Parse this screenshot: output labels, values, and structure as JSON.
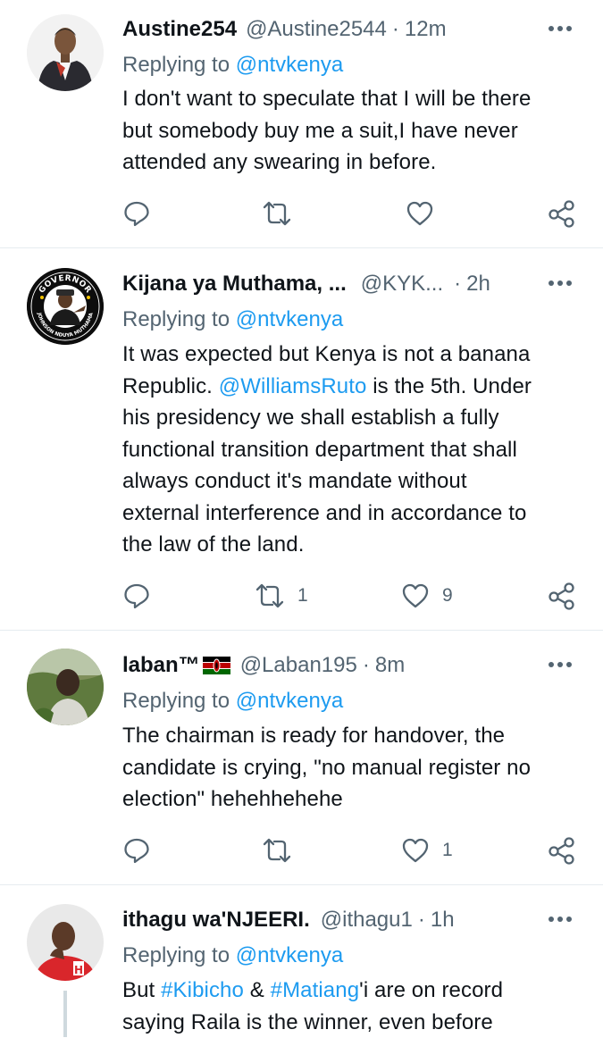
{
  "tweets": [
    {
      "name": "Austine254",
      "handle": "@Austine2544",
      "time": "12m",
      "replying_prefix": "Replying to ",
      "replying_handle": "@ntvkenya",
      "body_lines": [
        "I don't want to speculate that I will be there",
        "but somebody buy me a suit,I have never",
        "attended any swearing in before."
      ],
      "retweets": "",
      "likes": ""
    },
    {
      "name": "Kijana ya Muthama, ...",
      "handle": "@KYK...",
      "time": "2h",
      "replying_prefix": "Replying to ",
      "replying_handle": "@ntvkenya",
      "body_line1": "It was expected but Kenya is not a banana",
      "body_mention": "@WilliamsRuto",
      "body_line2_rest": " is the 5th. Under",
      "body_lines_rest": [
        "his presidency we shall establish a fully",
        "functional transition department that shall",
        "always conduct it's mandate without",
        "external interference and in accordance to",
        "the law of the land."
      ],
      "avatar_text_top": "GOVERNOR",
      "avatar_text_bottom": "JOHNSON NDUYA MUTHAMA",
      "retweets": "1",
      "likes": "9"
    },
    {
      "name": "laban™",
      "handle": "@Laban195",
      "time": "8m",
      "replying_prefix": "Replying to ",
      "replying_handle": "@ntvkenya",
      "body_lines": [
        "The chairman is ready for handover, the",
        "candidate is crying, \"no manual register no",
        "election\" hehehhehehe"
      ],
      "retweets": "",
      "likes": "1"
    },
    {
      "name": "ithagu wa'NJEERI.",
      "handle": "@ithagu1",
      "time": "1h",
      "replying_prefix": "Replying to ",
      "replying_handle": "@ntvkenya",
      "body_but": "But ",
      "hashtag1": "#Kibicho",
      "amp": " & ",
      "hashtag2": "#Matiang",
      "body_line1_rest": "'i are on record",
      "body_line2": "saying Raila is the winner, even before"
    }
  ],
  "separator": "·",
  "colors": {
    "link": "#1d9bf0",
    "secondary_text": "#536471",
    "divider": "#e6ecf0",
    "primary_text": "#0f1419"
  }
}
